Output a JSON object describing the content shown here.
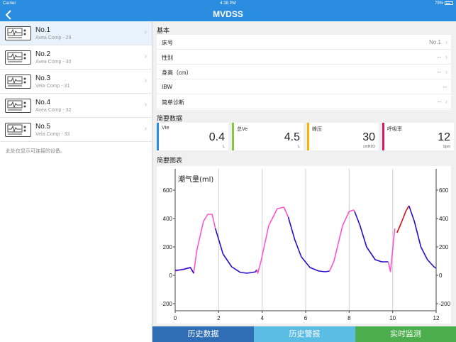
{
  "status_bar": {
    "carrier": "Carrier",
    "time": "4:38 PM",
    "battery": "79%"
  },
  "nav": {
    "title": "MVDSS",
    "back_icon": "chevron-left-icon"
  },
  "devices": [
    {
      "name": "No.1",
      "model": "Avea Comp - 29"
    },
    {
      "name": "No.2",
      "model": "Avea Comp - 30"
    },
    {
      "name": "No.3",
      "model": "Vela Comp - 31"
    },
    {
      "name": "No.4",
      "model": "Avea Comp - 32"
    },
    {
      "name": "No.5",
      "model": "Vela Comp - 33"
    }
  ],
  "sidebar_note": "此处仅显示可连接的设备。",
  "basic": {
    "section": "基本",
    "rows": [
      {
        "label": "床号",
        "value": "No.1"
      },
      {
        "label": "性别",
        "value": "--"
      },
      {
        "label": "身高（cm）",
        "value": "--"
      },
      {
        "label": "IBW",
        "value": "--"
      },
      {
        "label": "简单诊断",
        "value": "--"
      }
    ]
  },
  "summary": {
    "section": "简要数据",
    "cards": [
      {
        "name": "Vte",
        "value": "0.4",
        "unit": "L",
        "color": "#2b8de0"
      },
      {
        "name": "总Ve",
        "value": "4.5",
        "unit": "L",
        "color": "#8cc63f"
      },
      {
        "name": "峰压",
        "value": "30",
        "unit": "cmH2O",
        "color": "#f5b400"
      },
      {
        "name": "呼吸率",
        "value": "12",
        "unit": "bpm",
        "color": "#d81b60"
      }
    ]
  },
  "chart_section": "简要图表",
  "chart_data": {
    "type": "line",
    "title": "潮气量(ml)",
    "xlim": [
      0,
      12
    ],
    "ylim": [
      -250,
      750
    ],
    "x_ticks": [
      0,
      2,
      4,
      6,
      8,
      10,
      12
    ],
    "y_ticks": [
      -200,
      0,
      200,
      400,
      600
    ],
    "grid": "vertical",
    "series": [
      {
        "color": "#ff55cc",
        "x": [
          0,
          0.7,
          0.85,
          1.0,
          1.3,
          1.5,
          1.7,
          1.85
        ],
        "y": [
          30,
          55,
          15,
          180,
          380,
          430,
          430,
          330
        ]
      },
      {
        "color": "#2a0cc8",
        "x": [
          0,
          0.35,
          0.7,
          0.85
        ],
        "y": [
          35,
          40,
          55,
          15
        ]
      },
      {
        "color": "#2a0cc8",
        "x": [
          1.85,
          2.2,
          2.6,
          3.0,
          3.3,
          3.55,
          3.7,
          3.75
        ],
        "y": [
          330,
          150,
          60,
          20,
          15,
          20,
          25,
          40
        ]
      },
      {
        "color": "#ff55cc",
        "x": [
          3.75,
          3.8,
          3.95,
          4.3,
          4.7,
          5.0,
          5.2
        ],
        "y": [
          40,
          15,
          100,
          350,
          470,
          480,
          410
        ]
      },
      {
        "color": "#2a0cc8",
        "x": [
          5.2,
          5.5,
          5.8,
          6.2,
          6.6,
          6.9,
          7.1
        ],
        "y": [
          410,
          250,
          130,
          55,
          30,
          25,
          30
        ]
      },
      {
        "color": "#ff55cc",
        "x": [
          7.1,
          7.3,
          7.7,
          8.0,
          8.2,
          8.25
        ],
        "y": [
          30,
          100,
          350,
          450,
          460,
          450
        ]
      },
      {
        "color": "#2a0cc8",
        "x": [
          8.25,
          8.5,
          8.8,
          9.2,
          9.5,
          9.8
        ],
        "y": [
          450,
          350,
          200,
          110,
          95,
          95
        ]
      },
      {
        "color": "#ff55cc",
        "x": [
          9.8,
          9.9,
          10.1
        ],
        "y": [
          95,
          25,
          330
        ]
      },
      {
        "color": "#cc1111",
        "x": [
          10.2,
          10.4,
          10.6,
          10.75
        ],
        "y": [
          300,
          370,
          450,
          490
        ]
      },
      {
        "color": "#2a0cc8",
        "x": [
          10.75,
          11.0,
          11.3,
          11.6,
          11.9,
          12.0
        ],
        "y": [
          490,
          380,
          200,
          110,
          60,
          50
        ]
      }
    ]
  },
  "tabs": [
    {
      "label": "历史数据",
      "color": "#2f6db5"
    },
    {
      "label": "历史警报",
      "color": "#5bbde4"
    },
    {
      "label": "实时监测",
      "color": "#4cae4c"
    }
  ]
}
